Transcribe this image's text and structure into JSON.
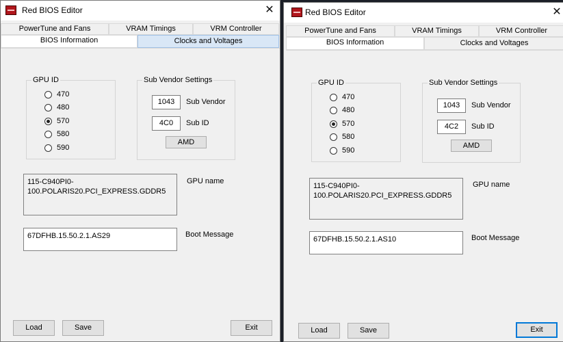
{
  "app": {
    "title": "Red BIOS Editor",
    "close": "✕"
  },
  "tabs": {
    "top": [
      "PowerTune and Fans",
      "VRAM Timings",
      "VRM Controller"
    ],
    "bottom": [
      "BIOS Information",
      "Clocks and Voltages"
    ]
  },
  "gpu_id": {
    "title": "GPU ID",
    "options": [
      "470",
      "480",
      "570",
      "580",
      "590"
    ],
    "selected": "570"
  },
  "sub_vendor": {
    "title": "Sub Vendor Settings",
    "vendor_label": "Sub Vendor",
    "id_label": "Sub ID",
    "vendor_button": "AMD"
  },
  "labels": {
    "gpu_name": "GPU name",
    "boot_message": "Boot Message"
  },
  "buttons": {
    "load": "Load",
    "save": "Save",
    "exit": "Exit"
  },
  "windows": [
    {
      "sub_vendor_value": "1043",
      "sub_id_value": "4C0",
      "gpu_name_text": "115-C940PI0-100.POLARIS20.PCI_EXPRESS.GDDR5",
      "boot_message_text": "67DFHB.15.50.2.1.AS29"
    },
    {
      "sub_vendor_value": "1043",
      "sub_id_value": "4C2",
      "gpu_name_text": "115-C940PI0-100.POLARIS20.PCI_EXPRESS.GDDR5",
      "boot_message_text": "67DFHB.15.50.2.1.AS10"
    }
  ]
}
